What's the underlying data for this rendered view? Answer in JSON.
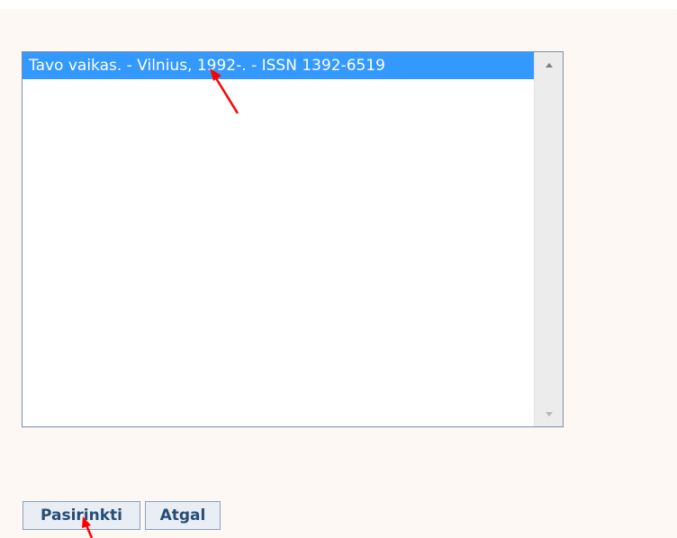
{
  "listbox": {
    "items": [
      {
        "label": "Tavo vaikas. - Vilnius, 1992-. - ISSN 1392-6519",
        "selected": true
      }
    ]
  },
  "buttons": {
    "select_label": "Pasirinkti",
    "back_label": "Atgal"
  },
  "colors": {
    "selection": "#3399ff",
    "annotation_arrow": "#ff0000",
    "button_text": "#264c78",
    "panel_background": "#fdf8f4"
  },
  "icons": {
    "scroll_up": "chevron-up-icon",
    "scroll_down": "chevron-down-icon",
    "annotations": "arrow-icon"
  }
}
